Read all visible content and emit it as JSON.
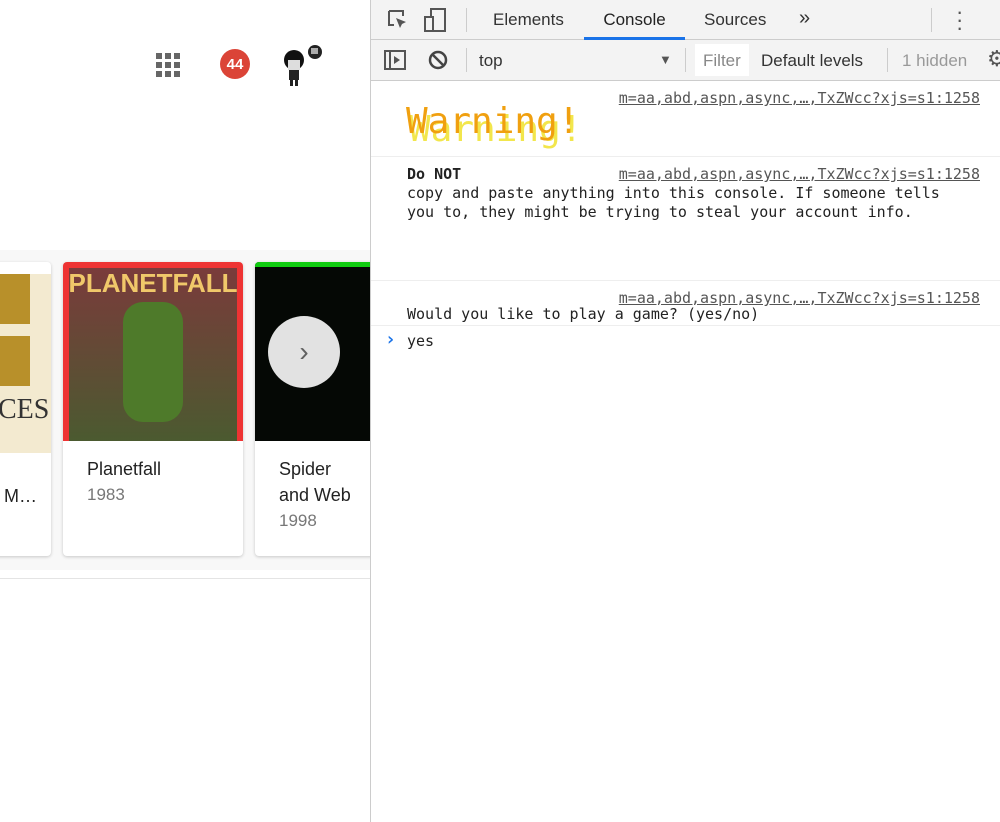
{
  "header": {
    "notification_count": "44"
  },
  "cards": [
    {
      "title": "M…",
      "year": ""
    },
    {
      "title": "Planetfall",
      "year": "1983",
      "cover_text": "PLANETFALL"
    },
    {
      "title": "Spider and Web",
      "year": "1998"
    }
  ],
  "devtools": {
    "tabs": [
      "Elements",
      "Console",
      "Sources"
    ],
    "active_tab": "Console",
    "more": "»",
    "context": "top",
    "filter_placeholder": "Filter",
    "levels": "Default levels",
    "hidden": "1 hidden",
    "accent": "#1a73e8",
    "messages": [
      {
        "source": "m=aa,abd,aspn,async,…,TxZWcc?xjs=s1:1258",
        "text": "Warning!"
      },
      {
        "source": "m=aa,abd,aspn,async,…,TxZWcc?xjs=s1:1258",
        "bold": "Do NOT",
        "text": "copy and paste anything into this console.  If someone tells you to, they might be trying to steal your account info."
      },
      {
        "source": "m=aa,abd,aspn,async,…,TxZWcc?xjs=s1:1258",
        "text": "Would you like to play a game? (yes/no)"
      }
    ],
    "input": "yes",
    "prompt": "›"
  }
}
